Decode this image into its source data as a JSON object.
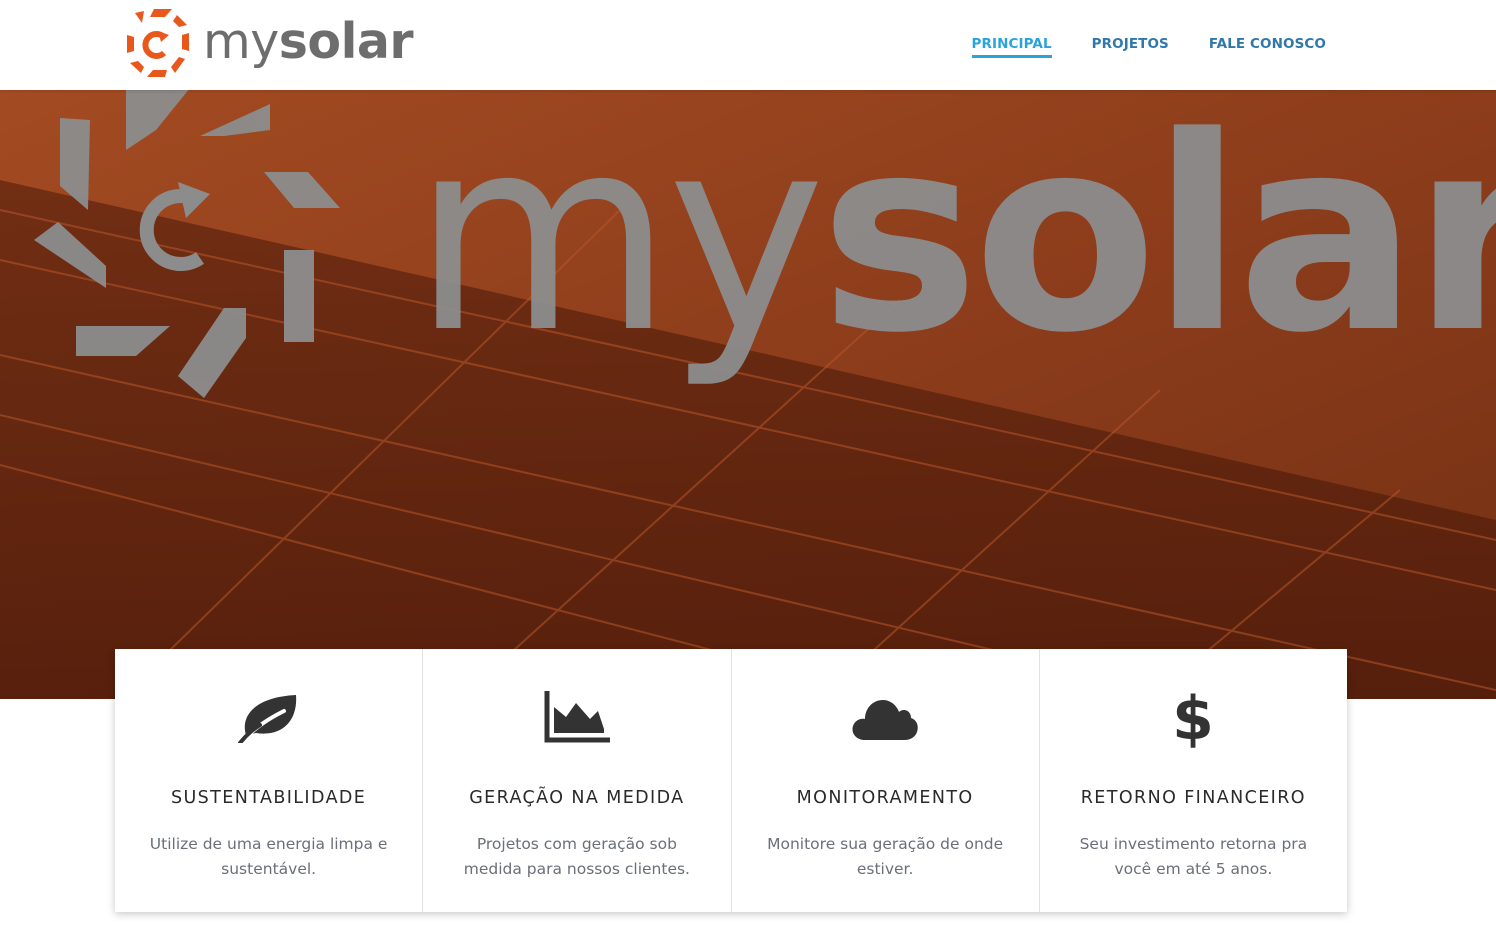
{
  "brand": {
    "name_light": "my",
    "name_bold": "solar",
    "accent": "#e8581d",
    "text_color": "#6d6d6d"
  },
  "nav": [
    {
      "label": "PRINCIPAL",
      "active": true
    },
    {
      "label": "PROJETOS",
      "active": false
    },
    {
      "label": "FALE CONOSCO",
      "active": false
    }
  ],
  "hero": {
    "word_light": "my",
    "word_bold": "solar"
  },
  "features": [
    {
      "icon": "leaf-icon",
      "title": "SUSTENTABILIDADE",
      "line1": "Utilize de uma energia limpa e",
      "line2": "sustentável."
    },
    {
      "icon": "area-chart-icon",
      "title": "GERAÇÃO NA MEDIDA",
      "line1": "Projetos com geração sob",
      "line2": "medida para nossos clientes."
    },
    {
      "icon": "cloud-icon",
      "title": "MONITORAMENTO",
      "line1": "Monitore sua geração de onde",
      "line2": "estiver."
    },
    {
      "icon": "dollar-icon",
      "title": "RETORNO FINANCEIRO",
      "line1": "Seu investimento retorna pra",
      "line2": "você em até 5 anos."
    }
  ],
  "colors": {
    "nav_link": "#2f78a9",
    "nav_active": "#2aa3da",
    "hero_bg": "#86391a",
    "icon_dark": "#333333"
  }
}
